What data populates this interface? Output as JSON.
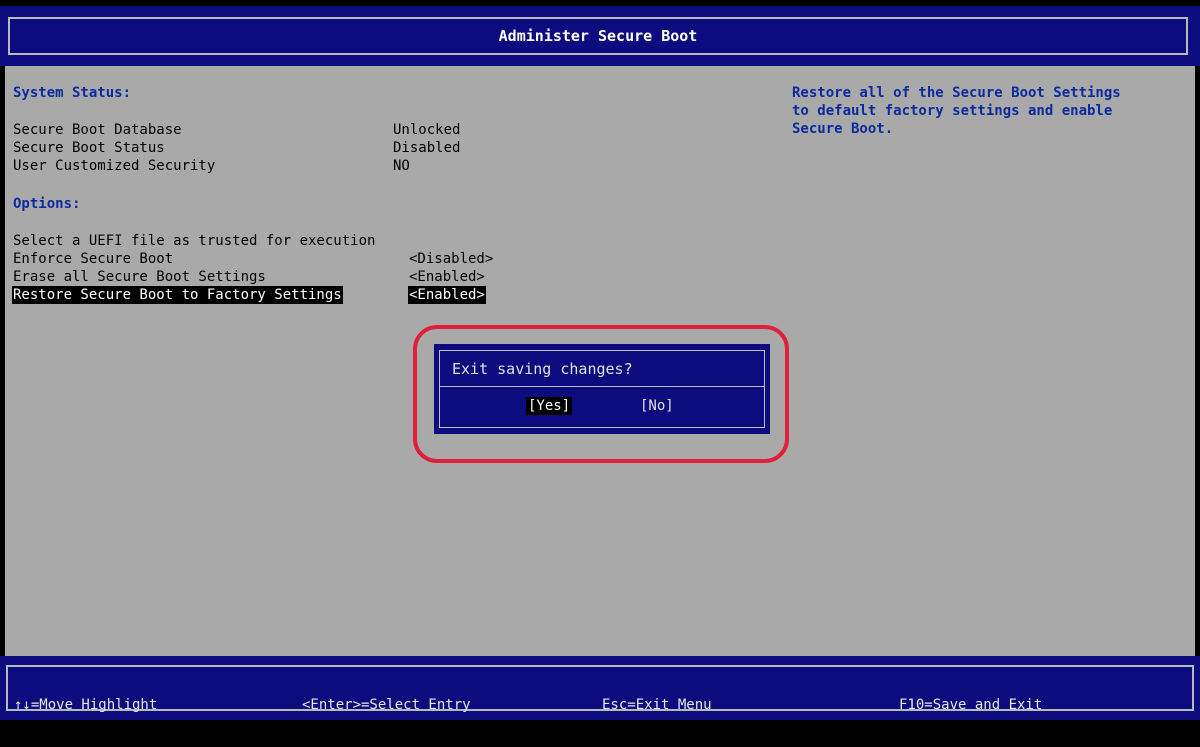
{
  "header": {
    "title": "Administer Secure Boot"
  },
  "status": {
    "heading": "System Status:",
    "rows": [
      {
        "label": "Secure Boot Database",
        "value": "Unlocked"
      },
      {
        "label": "Secure Boot Status",
        "value": "Disabled"
      },
      {
        "label": "User Customized Security",
        "value": "NO"
      }
    ]
  },
  "options": {
    "heading": "Options:",
    "items": [
      {
        "label": "Select a UEFI file as trusted for execution",
        "value": ""
      },
      {
        "label": "Enforce Secure Boot",
        "value": "<Disabled>"
      },
      {
        "label": "Erase all Secure Boot Settings",
        "value": "<Enabled>"
      },
      {
        "label": "Restore Secure Boot to Factory Settings",
        "value": "<Enabled>"
      }
    ]
  },
  "help": {
    "lines": [
      "Restore all of the Secure Boot Settings",
      "to default factory settings and enable",
      "Secure Boot."
    ]
  },
  "dialog": {
    "title": "Exit saving changes?",
    "yes": "[Yes]",
    "no": "[No]"
  },
  "footer": {
    "keys": [
      "↑↓=Move Highlight",
      "<Enter>=Select Entry",
      "Esc=Exit Menu",
      "F10=Save and Exit"
    ]
  },
  "colors": {
    "bios_blue": "#0c0c7e",
    "panel_gray": "#a9a9a9",
    "section_blue": "#0b2a9e",
    "annotation_red": "#e0203a"
  }
}
